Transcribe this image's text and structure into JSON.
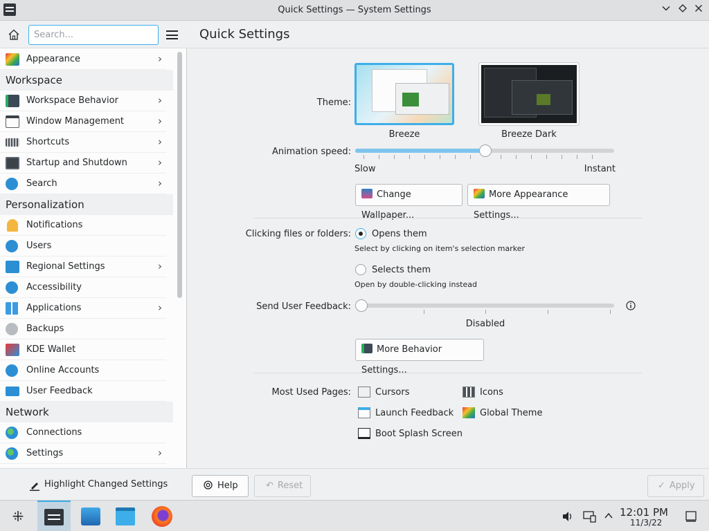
{
  "window": {
    "title": "Quick Settings — System Settings",
    "controls": [
      "minimize",
      "maximize",
      "close"
    ]
  },
  "sidebar": {
    "search_placeholder": "Search...",
    "items": [
      {
        "type": "item",
        "label": "Appearance",
        "icon": "appearance-icon",
        "chevron": true
      },
      {
        "type": "category",
        "label": "Workspace"
      },
      {
        "type": "item",
        "label": "Workspace Behavior",
        "icon": "workspace-behavior-icon",
        "chevron": true
      },
      {
        "type": "item",
        "label": "Window Management",
        "icon": "window-management-icon",
        "chevron": true
      },
      {
        "type": "item",
        "label": "Shortcuts",
        "icon": "keyboard-icon",
        "chevron": true
      },
      {
        "type": "item",
        "label": "Startup and Shutdown",
        "icon": "startup-icon",
        "chevron": true
      },
      {
        "type": "item",
        "label": "Search",
        "icon": "search-icon",
        "chevron": true
      },
      {
        "type": "category",
        "label": "Personalization"
      },
      {
        "type": "item",
        "label": "Notifications",
        "icon": "bell-icon",
        "chevron": false
      },
      {
        "type": "item",
        "label": "Users",
        "icon": "users-icon",
        "chevron": false
      },
      {
        "type": "item",
        "label": "Regional Settings",
        "icon": "regional-icon",
        "chevron": true
      },
      {
        "type": "item",
        "label": "Accessibility",
        "icon": "accessibility-icon",
        "chevron": false
      },
      {
        "type": "item",
        "label": "Applications",
        "icon": "applications-icon",
        "chevron": true
      },
      {
        "type": "item",
        "label": "Backups",
        "icon": "backups-icon",
        "chevron": false
      },
      {
        "type": "item",
        "label": "KDE Wallet",
        "icon": "wallet-icon",
        "chevron": false
      },
      {
        "type": "item",
        "label": "Online Accounts",
        "icon": "online-accounts-icon",
        "chevron": false
      },
      {
        "type": "item",
        "label": "User Feedback",
        "icon": "feedback-icon",
        "chevron": false
      },
      {
        "type": "category",
        "label": "Network"
      },
      {
        "type": "item",
        "label": "Connections",
        "icon": "globe-icon",
        "chevron": false
      },
      {
        "type": "item",
        "label": "Settings",
        "icon": "globe-icon",
        "chevron": true
      }
    ],
    "footer_label": "Highlight Changed Settings"
  },
  "main": {
    "page_title": "Quick Settings",
    "theme": {
      "label": "Theme:",
      "options": [
        {
          "name": "Breeze",
          "selected": true
        },
        {
          "name": "Breeze Dark",
          "selected": false
        }
      ]
    },
    "animation": {
      "label": "Animation speed:",
      "min_label": "Slow",
      "max_label": "Instant",
      "value": 0.5
    },
    "buttons_appearance": {
      "wallpaper": "Change Wallpaper...",
      "appearance": "More Appearance Settings..."
    },
    "clicking": {
      "label": "Clicking files or folders:",
      "option1": "Opens them",
      "option1_hint": "Select by clicking on item's selection marker",
      "option2": "Selects them",
      "option2_hint": "Open by double-clicking instead",
      "selected": "option1"
    },
    "feedback": {
      "label": "Send User Feedback:",
      "value_label": "Disabled",
      "value": 0
    },
    "behavior_button": "More Behavior Settings...",
    "most_used": {
      "label": "Most Used Pages:",
      "pages": [
        {
          "label": "Cursors",
          "icon": "cursors-icon"
        },
        {
          "label": "Icons",
          "icon": "icons-icon"
        },
        {
          "label": "Launch Feedback",
          "icon": "launch-feedback-icon"
        },
        {
          "label": "Global Theme",
          "icon": "global-theme-icon"
        },
        {
          "label": "Boot Splash Screen",
          "icon": "boot-splash-icon"
        }
      ]
    },
    "bottom": {
      "help": "Help",
      "reset": "Reset",
      "apply": "Apply"
    }
  },
  "taskbar": {
    "time": "12:01 PM",
    "date": "11/3/22"
  },
  "colors": {
    "accent": "#3daee9",
    "background": "#eff0f1",
    "view": "#fcfcfc"
  }
}
